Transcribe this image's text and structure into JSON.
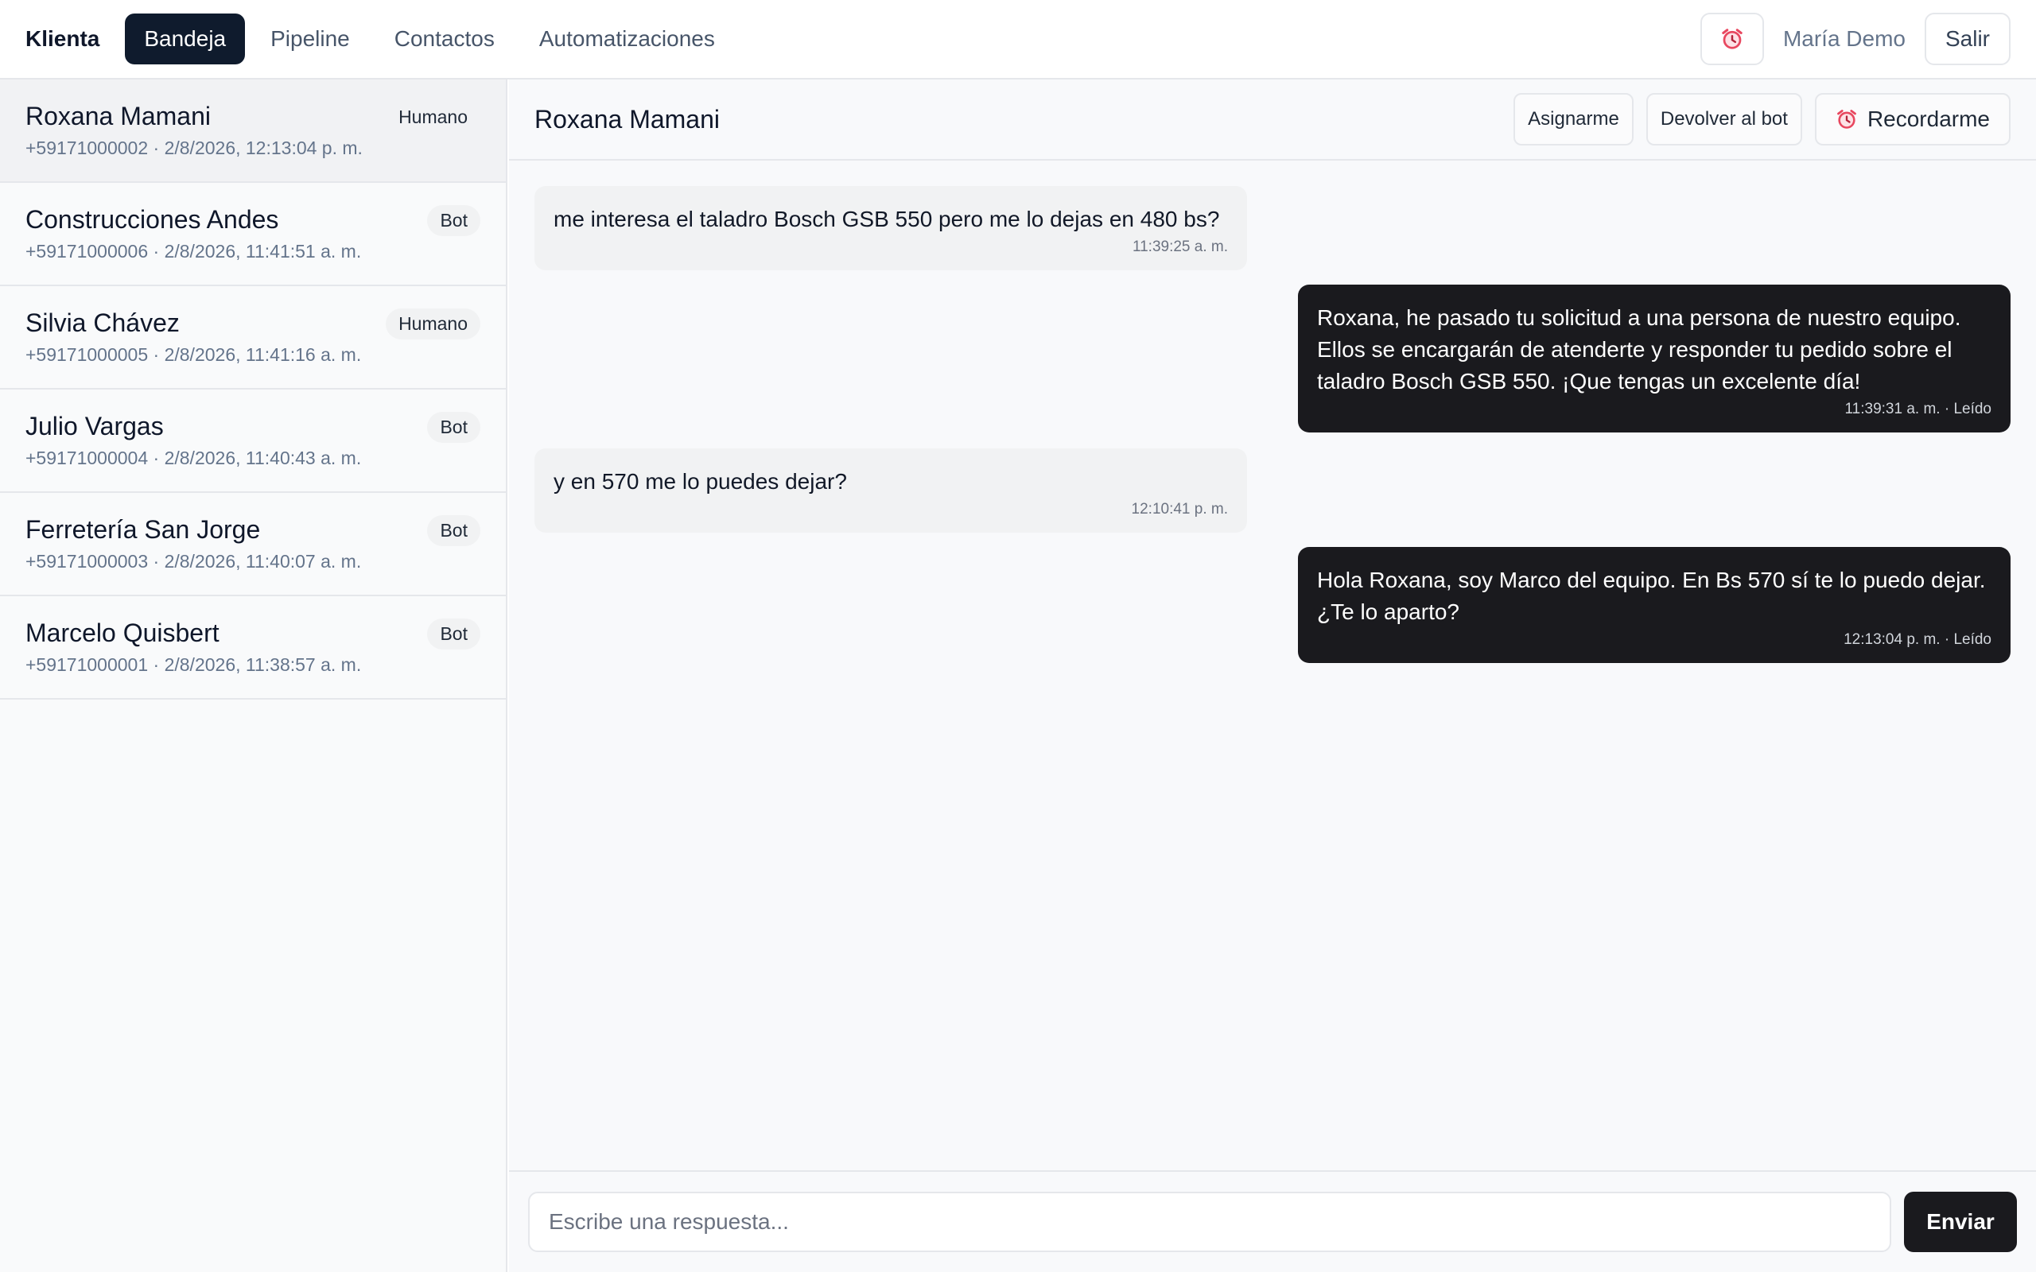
{
  "app": {
    "brand": "Klienta"
  },
  "nav": {
    "items": [
      {
        "label": "Bandeja",
        "active": true
      },
      {
        "label": "Pipeline"
      },
      {
        "label": "Contactos"
      },
      {
        "label": "Automatizaciones"
      }
    ]
  },
  "topbar": {
    "alarm_icon": "alarm-clock-icon",
    "user_name": "María Demo",
    "logout_label": "Salir"
  },
  "conversations": [
    {
      "name": "Roxana Mamani",
      "meta": "+59171000002 · 2/8/2026, 12:13:04 p. m.",
      "badge": "Humano",
      "selected": true
    },
    {
      "name": "Construcciones Andes",
      "meta": "+59171000006 · 2/8/2026, 11:41:51 a. m.",
      "badge": "Bot"
    },
    {
      "name": "Silvia Chávez",
      "meta": "+59171000005 · 2/8/2026, 11:41:16 a. m.",
      "badge": "Humano"
    },
    {
      "name": "Julio Vargas",
      "meta": "+59171000004 · 2/8/2026, 11:40:43 a. m.",
      "badge": "Bot"
    },
    {
      "name": "Ferretería San Jorge",
      "meta": "+59171000003 · 2/8/2026, 11:40:07 a. m.",
      "badge": "Bot"
    },
    {
      "name": "Marcelo Quisbert",
      "meta": "+59171000001 · 2/8/2026, 11:38:57 a. m.",
      "badge": "Bot"
    }
  ],
  "chat": {
    "title": "Roxana Mamani",
    "actions": {
      "assign": "Asignarme",
      "return_bot": "Devolver al bot",
      "remind": "Recordarme"
    },
    "messages": [
      {
        "direction": "in",
        "text": "me interesa el taladro Bosch GSB 550 pero me lo dejas en 480 bs?",
        "time": "11:39:25 a. m."
      },
      {
        "direction": "out",
        "text": "Roxana, he pasado tu solicitud a una persona de nuestro equipo. Ellos se encargarán de atenderte y responder tu pedido sobre el taladro Bosch GSB 550. ¡Que tengas un excelente día!",
        "time": "11:39:31 a. m. · Leído"
      },
      {
        "direction": "in",
        "text": "y en 570 me lo puedes dejar?",
        "time": "12:10:41 p. m."
      },
      {
        "direction": "out",
        "text": "Hola Roxana, soy Marco del equipo. En Bs 570 sí te lo puedo dejar. ¿Te lo aparto?",
        "time": "12:13:04 p. m. · Leído"
      }
    ],
    "composer": {
      "placeholder": "Escribe una respuesta...",
      "send_label": "Enviar"
    }
  },
  "colors": {
    "accent_dark": "#0f1b2d",
    "bubble_out": "#1a1a1e",
    "bubble_in": "#f1f2f3",
    "alarm": "#e8475f"
  }
}
